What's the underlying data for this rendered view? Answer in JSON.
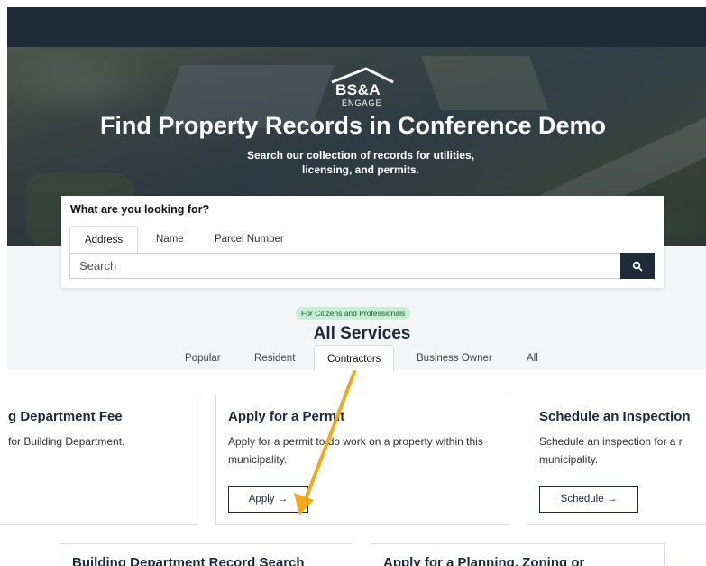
{
  "hero": {
    "logo_brand": "BS&A",
    "logo_sub": "ENGAGE",
    "title": "Find Property Records in Conference Demo",
    "subtitle": "Search our collection of records for utilities, licensing, and permits."
  },
  "search": {
    "question": "What are you looking for?",
    "tabs": [
      "Address",
      "Name",
      "Parcel Number"
    ],
    "active_tab": "Address",
    "placeholder": "Search"
  },
  "services": {
    "badge": "For Citizens and Professionals",
    "title": "All Services",
    "tabs": [
      "Popular",
      "Resident",
      "Contractors",
      "Business Owner",
      "All"
    ],
    "active_tab": "Contractors"
  },
  "cards": [
    {
      "title": "g Department Fee",
      "desc": "for Building Department.",
      "button": ""
    },
    {
      "title": "Apply for a Permit",
      "desc": "Apply for a permit to do work on a property within this municipality.",
      "button": "Apply →"
    },
    {
      "title": "Schedule an Inspection",
      "desc": "Schedule an inspection for a r municipality.",
      "button": "Schedule →"
    },
    {
      "title": "Building Department Record Search",
      "desc": "",
      "button": ""
    },
    {
      "title": "Apply for a Planning, Zoning or",
      "desc": "",
      "button": ""
    }
  ],
  "colors": {
    "navy": "#1e2a38",
    "badge_bg": "#c7efd5",
    "arrow": "#f0a91c"
  }
}
